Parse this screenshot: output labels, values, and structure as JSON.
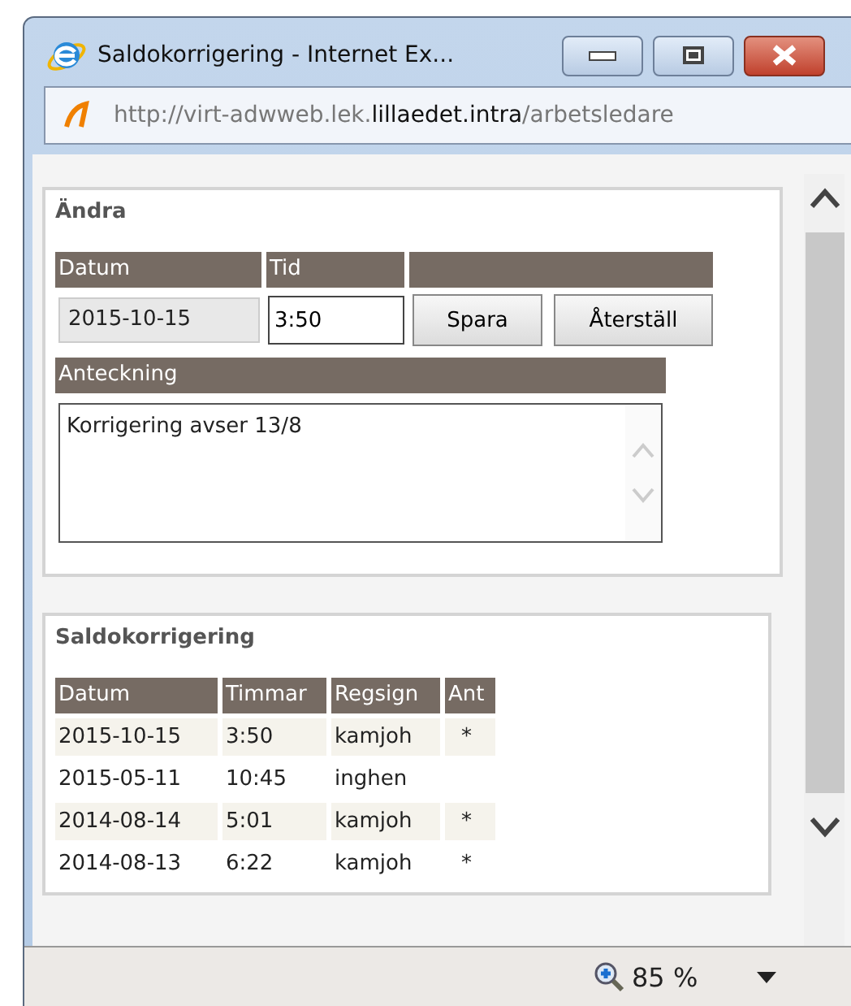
{
  "window": {
    "title": "Saldokorrigering - Internet Ex..."
  },
  "address_bar": {
    "url_start": "http://virt-adwweb.lek.",
    "url_domain": "lillaedet.intra",
    "url_end": "/arbetsledare"
  },
  "edit_panel": {
    "heading": "Ändra",
    "columns": [
      "Datum",
      "Tid"
    ],
    "date": "2015-10-15",
    "time": "3:50",
    "buttons": [
      "Spara",
      "Återställ"
    ],
    "note_label": "Anteckning",
    "note": "Korrigering avser 13/8"
  },
  "history": {
    "heading": "Saldokorrigering",
    "columns": [
      "Datum",
      "Timmar",
      "Regsign",
      "Ant"
    ],
    "rows": [
      [
        "2015-10-15",
        "3:50",
        "kamjoh",
        "*"
      ],
      [
        "2015-05-11",
        "10:45",
        "inghen",
        ""
      ],
      [
        "2014-08-14",
        "5:01",
        "kamjoh",
        "*"
      ],
      [
        "2014-08-13",
        "6:22",
        "kamjoh",
        "*"
      ]
    ]
  },
  "status_bar": {
    "zoom": "85 %"
  }
}
